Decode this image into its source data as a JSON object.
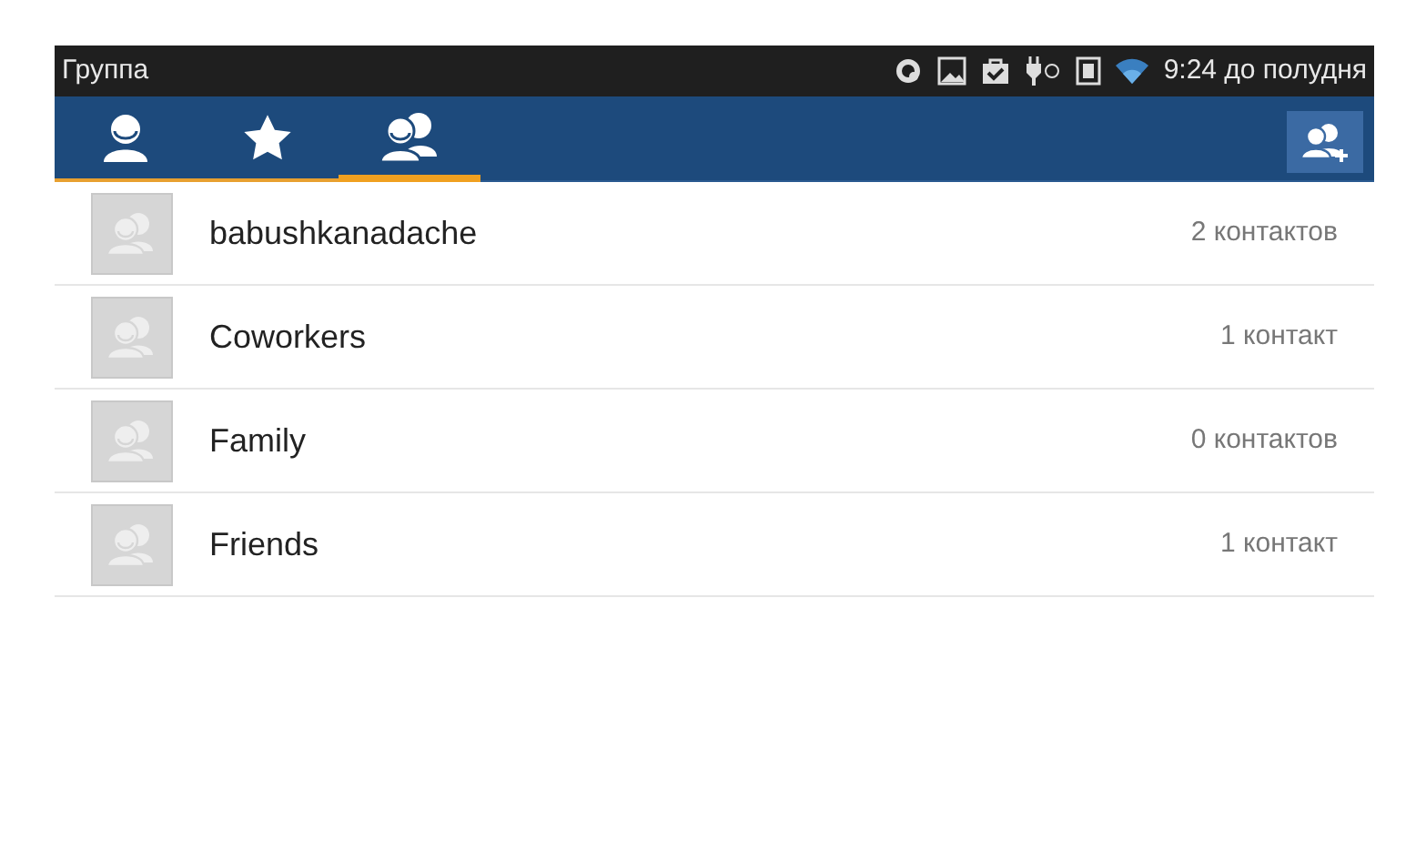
{
  "status_bar": {
    "title": "Группа",
    "time": "9:24 до полудня"
  },
  "tabs": [
    {
      "kind": "person",
      "selected": false
    },
    {
      "kind": "star",
      "selected": false
    },
    {
      "kind": "group",
      "selected": true
    }
  ],
  "groups": [
    {
      "name": "babushkanadache",
      "count": "2 контактов"
    },
    {
      "name": "Coworkers",
      "count": "1 контакт"
    },
    {
      "name": "Family",
      "count": "0 контактов"
    },
    {
      "name": "Friends",
      "count": "1 контакт"
    }
  ]
}
